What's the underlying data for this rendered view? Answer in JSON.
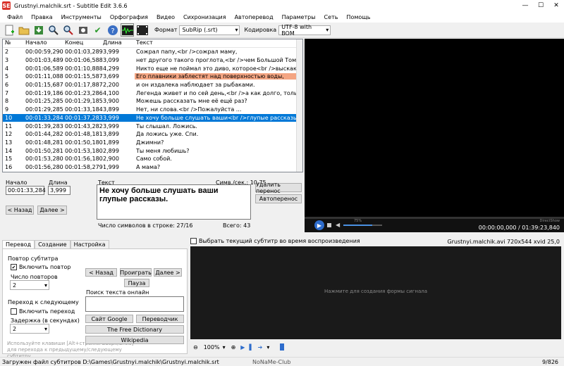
{
  "window": {
    "title": "Grustnyi.malchik.srt - Subtitle Edit 3.6.6",
    "app_icon": "SE"
  },
  "menu": [
    "Файл",
    "Правка",
    "Инструменты",
    "Орфография",
    "Видео",
    "Сихронизация",
    "Автоперевод",
    "Параметры",
    "Сеть",
    "Помощь"
  ],
  "toolbar": {
    "format_label": "Формат",
    "format_value": "SubRip (.srt)",
    "encoding_label": "Кодировка",
    "encoding_value": "UTF-8 with BOM"
  },
  "grid": {
    "headers": [
      "№",
      "Начало",
      "Конец",
      "Длина",
      "Текст"
    ],
    "rows": [
      {
        "n": "2",
        "start": "00:00:59,290",
        "end": "00:01:03,289",
        "dur": "3,999",
        "text": "Сожрал папу,<br />сожрал маму,",
        "state": ""
      },
      {
        "n": "3",
        "start": "00:01:03,489",
        "end": "00:01:06,588",
        "dur": "3,099",
        "text": "нет другого такого проглота,<br />чем Большой Том.",
        "state": ""
      },
      {
        "n": "4",
        "start": "00:01:06,589",
        "end": "00:01:10,888",
        "dur": "4,299",
        "text": "Никто еще не поймал это диво, которое<br />выскакивает из в...",
        "state": ""
      },
      {
        "n": "5",
        "start": "00:01:11,088",
        "end": "00:01:15,587",
        "dur": "3,699",
        "text": "Его плавники заблестят над поверхностью воды,",
        "state": "err"
      },
      {
        "n": "6",
        "start": "00:01:15,687",
        "end": "00:01:17,887",
        "dur": "2,200",
        "text": "и он издалека наблюдает за рыбаками.",
        "state": ""
      },
      {
        "n": "7",
        "start": "00:01:19,186",
        "end": "00:01:23,286",
        "dur": "4,100",
        "text": "Легенда живет и по сей день,<br />а как долго, только Бог зна...",
        "state": ""
      },
      {
        "n": "8",
        "start": "00:01:25,285",
        "end": "00:01:29,185",
        "dur": "3,900",
        "text": "Можешь рассказать мне её ещё раз?",
        "state": ""
      },
      {
        "n": "9",
        "start": "00:01:29,285",
        "end": "00:01:33,184",
        "dur": "3,899",
        "text": "Нет, ни слова.<br />Пожалуйста ...",
        "state": ""
      },
      {
        "n": "10",
        "start": "00:01:33,284",
        "end": "00:01:37,283",
        "dur": "3,999",
        "text": "Не хочу больше слушать ваши<br />глупые рассказы.",
        "state": "selected"
      },
      {
        "n": "11",
        "start": "00:01:39,283",
        "end": "00:01:43,282",
        "dur": "3,999",
        "text": "Ты слышал. Ложись.",
        "state": ""
      },
      {
        "n": "12",
        "start": "00:01:44,282",
        "end": "00:01:48,181",
        "dur": "3,899",
        "text": "Да ложись уже. Спи.",
        "state": ""
      },
      {
        "n": "13",
        "start": "00:01:48,281",
        "end": "00:01:50,180",
        "dur": "1,899",
        "text": "Джимни?",
        "state": ""
      },
      {
        "n": "14",
        "start": "00:01:50,281",
        "end": "00:01:53,180",
        "dur": "2,899",
        "text": "Ты меня любишь?",
        "state": ""
      },
      {
        "n": "15",
        "start": "00:01:53,280",
        "end": "00:01:56,180",
        "dur": "2,900",
        "text": "Само собой.",
        "state": ""
      },
      {
        "n": "16",
        "start": "00:01:56,280",
        "end": "00:01:58,279",
        "dur": "1,999",
        "text": "А мама?",
        "state": ""
      }
    ]
  },
  "edit": {
    "start_label": "Начало",
    "start_value": "00:01:33,284",
    "dur_label": "Длина",
    "dur_value": "3,999",
    "text_label": "Текст",
    "cps_label": "Симв./сек.: 10,75",
    "text_value_line1": "Не хочу больше слушать ваши",
    "text_value_line2": "глупые рассказы.",
    "line_chars": "Число символов в строке: 27/16",
    "total": "Всего: 43",
    "remove_break": "Удалить перенос",
    "auto_break": "Автоперенос",
    "prev": "< Назад",
    "next": "Далее >"
  },
  "player": {
    "time": "00:00:00,000 / 01:39:23,840",
    "volume": "75%",
    "renderer": "DirectShow"
  },
  "tabs": [
    "Перевод",
    "Создание",
    "Настройка"
  ],
  "translate": {
    "repeat_group": "Повтор субтитра",
    "repeat_check": "Включить повтор",
    "repeat_count_label": "Число повторов",
    "repeat_count_value": "2",
    "next_group": "Переход к следующему",
    "next_check": "Включить переход",
    "delay_label": "Задержка (в секундах)",
    "delay_value": "2",
    "hint": "Используйте клавиши [Alt+стрелки Вверх/Вниз] для перехода к предыдущему/следующему субтитру.",
    "back": "< Назад",
    "play": "Проиграть",
    "forward": "Далее >",
    "pause": "Пауза",
    "search_label": "Поиск текста онлайн",
    "google": "Сайт Google",
    "translator": "Переводчик",
    "free_dict": "The Free Dictionary",
    "wiki": "Wikipedia"
  },
  "waveform": {
    "check_label": "Выбрать текущий субтитр во время воспроизведения",
    "file_info": "Grustnyi.malchik.avi 720x544 xvid 25,0",
    "placeholder": "Нажмите для создания формы сигнала",
    "zoom": "100%"
  },
  "status": {
    "text": "Загружен файл субтитров D:\\Games\\Grustnyi.malchik\\Grustnyi.malchik.srt",
    "count": "9/826",
    "watermark": "NoNaMe-Club"
  },
  "colors": {
    "selection": "#0078d7",
    "error_row": "#f4a582",
    "video_bg": "#000000",
    "wave_bg": "#1a1a1a"
  }
}
